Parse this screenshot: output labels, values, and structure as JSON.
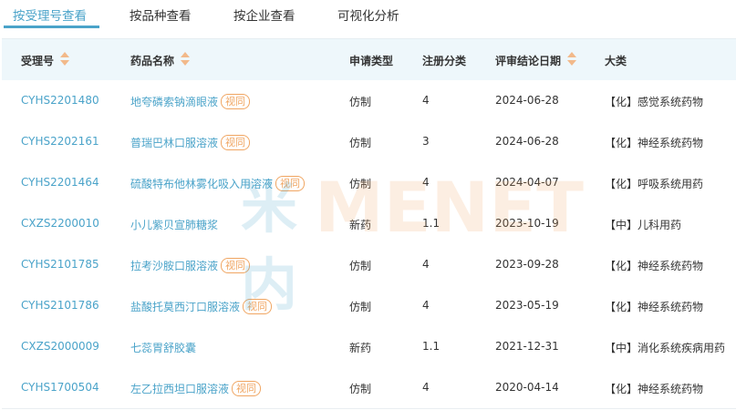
{
  "tabs": [
    {
      "label": "按受理号查看",
      "active": true
    },
    {
      "label": "按品种查看",
      "active": false
    },
    {
      "label": "按企业查看",
      "active": false
    },
    {
      "label": "可视化分析",
      "active": false
    }
  ],
  "table": {
    "headers": {
      "accept_no": "受理号",
      "drug_name": "药品名称",
      "app_type": "申请类型",
      "reg_class": "注册分类",
      "review_date": "评审结论日期",
      "category": "大类"
    },
    "rows": [
      {
        "accept_no": "CYHS2201480",
        "drug_name": "地夸磷索钠滴眼液",
        "badge": "视同",
        "app_type": "仿制",
        "reg_class": "4",
        "review_date": "2024-06-28",
        "category": "【化】感觉系统药物"
      },
      {
        "accept_no": "CYHS2202161",
        "drug_name": "普瑞巴林口服溶液",
        "badge": "视同",
        "app_type": "仿制",
        "reg_class": "3",
        "review_date": "2024-06-28",
        "category": "【化】神经系统药物"
      },
      {
        "accept_no": "CYHS2201464",
        "drug_name": "硫酸特布他林雾化吸入用溶液",
        "badge": "视同",
        "app_type": "仿制",
        "reg_class": "4",
        "review_date": "2024-04-07",
        "category": "【化】呼吸系统用药"
      },
      {
        "accept_no": "CXZS2200010",
        "drug_name": "小儿紫贝宣肺糖浆",
        "badge": "",
        "app_type": "新药",
        "reg_class": "1.1",
        "review_date": "2023-10-19",
        "category": "【中】儿科用药"
      },
      {
        "accept_no": "CYHS2101785",
        "drug_name": "拉考沙胺口服溶液",
        "badge": "视同",
        "app_type": "仿制",
        "reg_class": "4",
        "review_date": "2023-09-28",
        "category": "【化】神经系统药物"
      },
      {
        "accept_no": "CYHS2101786",
        "drug_name": "盐酸托莫西汀口服溶液",
        "badge": "视同",
        "app_type": "仿制",
        "reg_class": "4",
        "review_date": "2023-05-19",
        "category": "【化】神经系统药物"
      },
      {
        "accept_no": "CXZS2000009",
        "drug_name": "七蕊胃舒胶囊",
        "badge": "",
        "app_type": "新药",
        "reg_class": "1.1",
        "review_date": "2021-12-31",
        "category": "【中】消化系统疾病用药"
      },
      {
        "accept_no": "CYHS1700504",
        "drug_name": "左乙拉西坦口服溶液",
        "badge": "视同",
        "app_type": "仿制",
        "reg_class": "4",
        "review_date": "2020-04-14",
        "category": "【化】神经系统药物"
      }
    ]
  },
  "watermark": {
    "cn": "米内",
    "en": "MENET"
  },
  "colors": {
    "accent": "#4aa3c9",
    "badge": "#f0a663",
    "header_bg": "#eef7fb"
  }
}
